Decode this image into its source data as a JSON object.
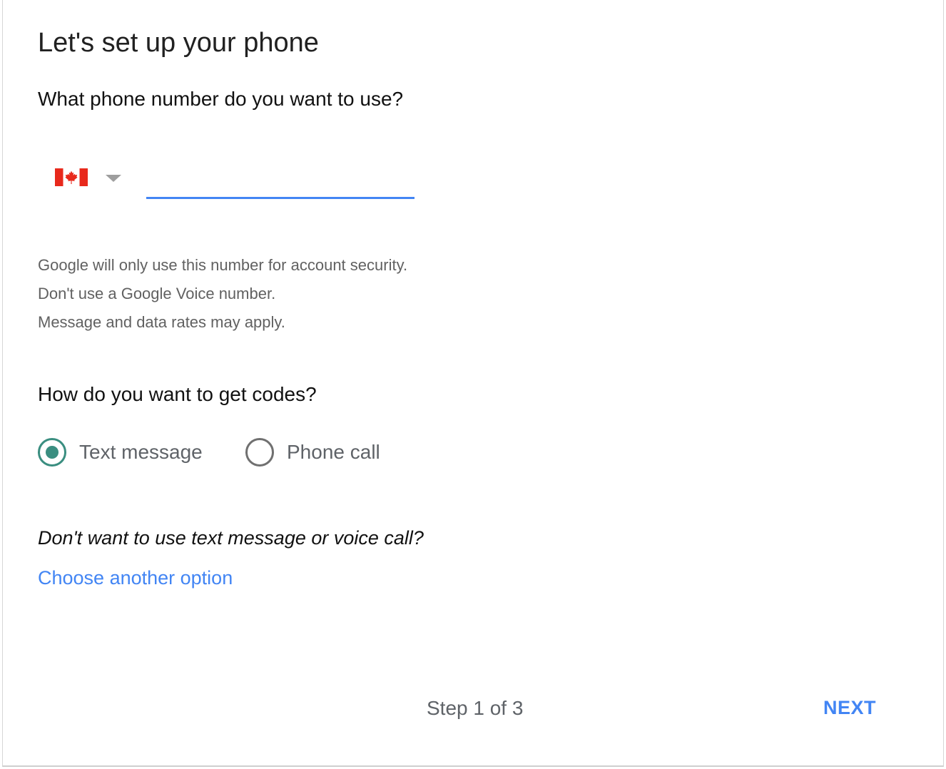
{
  "page": {
    "title": "Let's set up your phone"
  },
  "phone": {
    "question": "What phone number do you want to use?",
    "country_flag_icon": "canada-flag-icon",
    "country_dropdown_icon": "caret-down-icon",
    "input_value": "",
    "input_placeholder": "",
    "accent_color": "#4285f4"
  },
  "notes": [
    "Google will only use this number for account security.",
    "Don't use a Google Voice number.",
    "Message and data rates may apply."
  ],
  "codes": {
    "question": "How do you want to get codes?",
    "options": [
      {
        "label": "Text message",
        "selected": true
      },
      {
        "label": "Phone call",
        "selected": false
      }
    ],
    "selected_color": "#3a8e80"
  },
  "alternative": {
    "question": "Don't want to use text message or voice call?",
    "link_label": "Choose another option"
  },
  "footer": {
    "step_text": "Step 1 of 3",
    "next_label": "NEXT"
  }
}
